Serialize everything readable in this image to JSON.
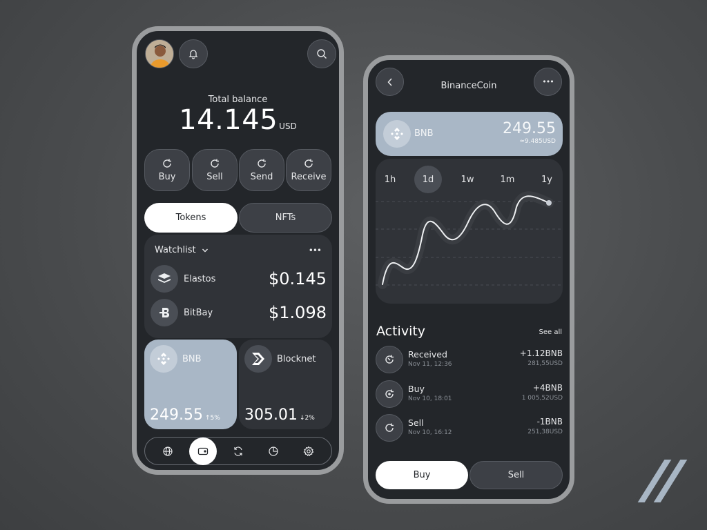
{
  "left_phone": {
    "total_balance_label": "Total balance",
    "total_balance_value": "14.145",
    "total_balance_unit": "USD",
    "actions": [
      {
        "label": "Buy",
        "icon": "refresh-icon"
      },
      {
        "label": "Sell",
        "icon": "refresh-icon"
      },
      {
        "label": "Send",
        "icon": "refresh-icon"
      },
      {
        "label": "Receive",
        "icon": "refresh-icon"
      }
    ],
    "tabs": [
      {
        "label": "Tokens",
        "active": true
      },
      {
        "label": "NFTs",
        "active": false
      }
    ],
    "watchlist": {
      "title": "Watchlist",
      "more": "•••",
      "items": [
        {
          "name": "Elastos",
          "price": "$0.145",
          "icon": "elastos-icon"
        },
        {
          "name": "BitBay",
          "price": "$1.098",
          "icon": "bitbay-icon"
        }
      ]
    },
    "tiles": [
      {
        "name": "BNB",
        "value": "249.55",
        "change": "↑5%",
        "icon": "bnb-icon"
      },
      {
        "name": "Blocknet",
        "value": "305.01",
        "change": "↓2%",
        "icon": "blocknet-icon"
      }
    ],
    "nav": [
      {
        "icon": "globe-icon",
        "active": false
      },
      {
        "icon": "wallet-icon",
        "active": true
      },
      {
        "icon": "exchange-icon",
        "active": false
      },
      {
        "icon": "pie-chart-icon",
        "active": false
      },
      {
        "icon": "settings-icon",
        "active": false
      }
    ]
  },
  "right_phone": {
    "title": "BinanceCoin",
    "more": "•••",
    "coin": {
      "name": "BNB",
      "value": "249.55",
      "sub": "≈9.485USD"
    },
    "periods": [
      {
        "label": "1h",
        "active": false
      },
      {
        "label": "1d",
        "active": true
      },
      {
        "label": "1w",
        "active": false
      },
      {
        "label": "1m",
        "active": false
      },
      {
        "label": "1y",
        "active": false
      }
    ],
    "activity_title": "Activity",
    "see_all": "See all",
    "activity": [
      {
        "name": "Received",
        "date": "Nov 11, 12:36",
        "amount": "+1.12BNB",
        "usd": "281,55USD",
        "icon": "receive-icon"
      },
      {
        "name": "Buy",
        "date": "Nov 10, 18:01",
        "amount": "+4BNB",
        "usd": "1 005,52USD",
        "icon": "buy-icon"
      },
      {
        "name": "Sell",
        "date": "Nov 10, 16:12",
        "amount": "-1BNB",
        "usd": "251,38USD",
        "icon": "sell-icon"
      }
    ],
    "buy_label": "Buy",
    "sell_label": "Sell"
  },
  "colors": {
    "background": "#4a4c4e",
    "phone_bg": "#23262a",
    "card_bg": "#303338",
    "accent": "#a9b7c6",
    "frame": "#9a9c9e"
  }
}
